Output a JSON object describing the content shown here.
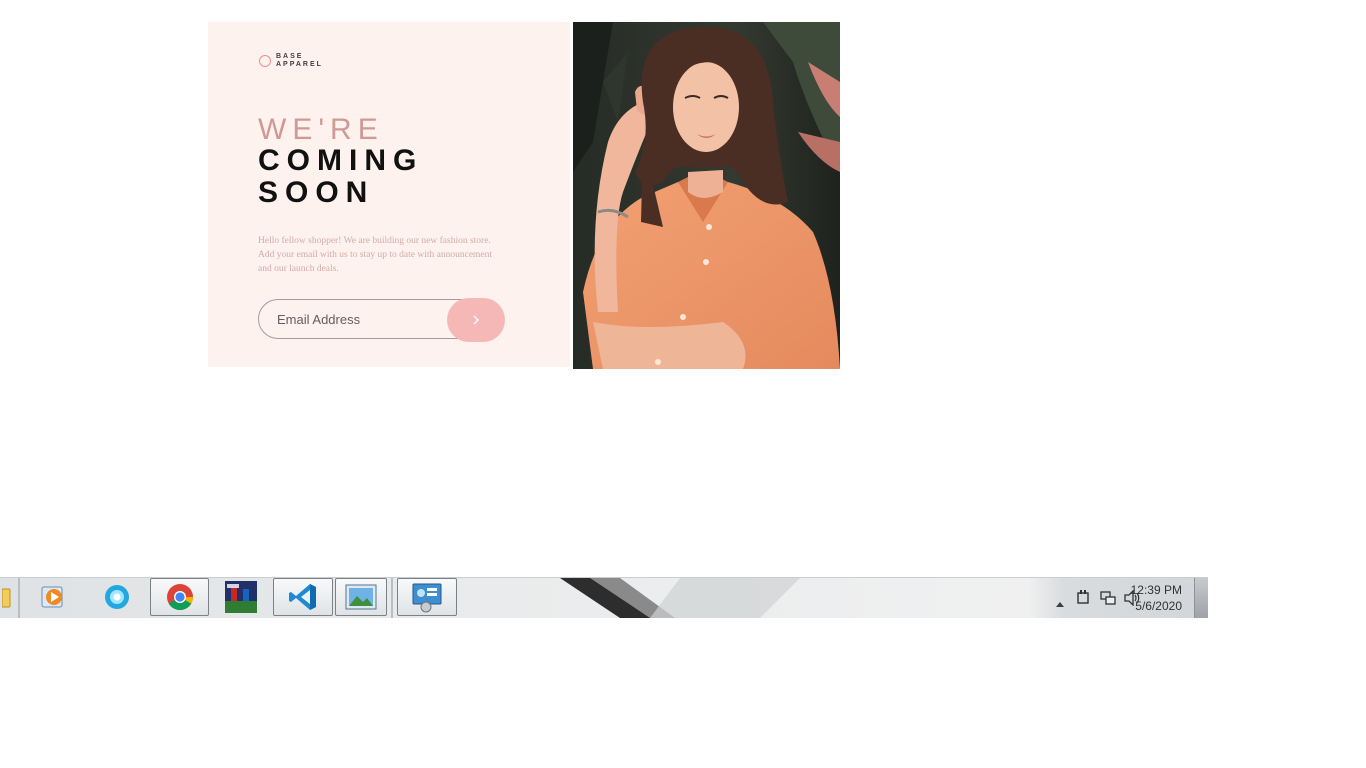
{
  "brand": {
    "line1": "BASE",
    "line2": "APPAREL",
    "accent_color": "#e8928f"
  },
  "hero": {
    "headline_light": "WE'RE",
    "headline_dark_1": "COMING",
    "headline_dark_2": "SOON",
    "description": "Hello fellow shopper! We are building our new fashion store. Add your email with us to stay up to date with announcement and our launch deals."
  },
  "form": {
    "email_placeholder": "Email Address",
    "submit_icon": "chevron-right-icon",
    "button_color": "#f5b8b6"
  },
  "photo": {
    "icon": "model-photo"
  },
  "taskbar": {
    "apps": [
      {
        "icon": "explorer-folder-icon"
      },
      {
        "icon": "media-player-icon"
      },
      {
        "icon": "browser-orb-icon"
      },
      {
        "icon": "chrome-icon"
      },
      {
        "icon": "game-icon"
      },
      {
        "icon": "vscode-icon"
      },
      {
        "icon": "photo-viewer-icon"
      },
      {
        "icon": "control-panel-icon"
      }
    ],
    "clock_time": "12:39 PM",
    "clock_date": "5/6/2020"
  }
}
